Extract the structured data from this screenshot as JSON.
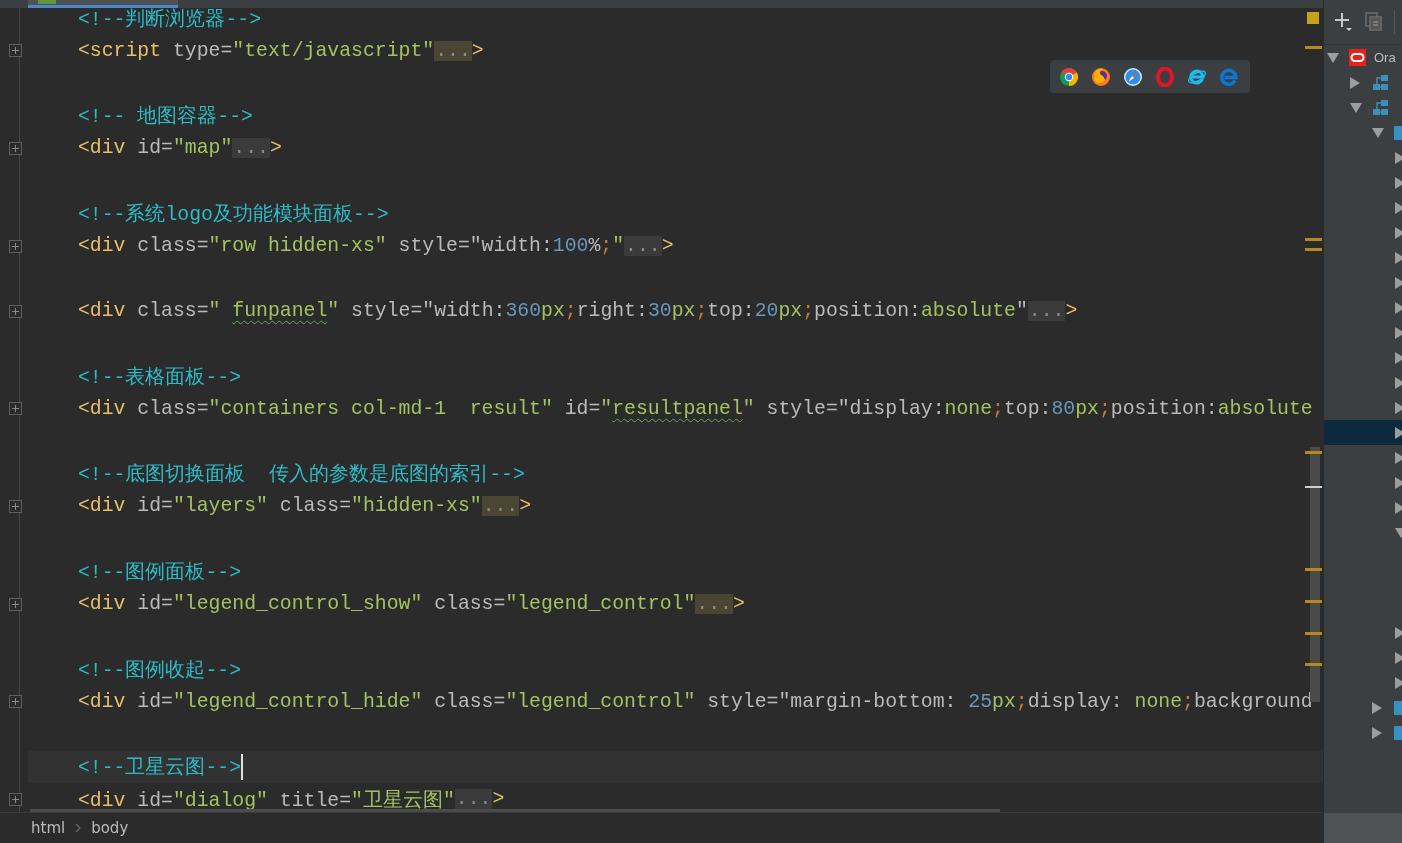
{
  "editor": {
    "lines": [
      {
        "kind": "code",
        "current": false,
        "collapsed": false,
        "tokens": [
          {
            "kind": "comment",
            "text": "<!--判断浏览器-->"
          }
        ]
      },
      {
        "kind": "code",
        "current": false,
        "collapsed": true,
        "tokens": [
          {
            "kind": "tag",
            "text": "<script"
          },
          {
            "kind": "attr",
            "text": " type="
          },
          {
            "kind": "value",
            "text": "\"text/javascript\""
          },
          {
            "kind": "fold",
            "text": "...",
            "highlighted": true
          },
          {
            "kind": "tag",
            "text": ">"
          }
        ]
      },
      {
        "kind": "blank",
        "current": false,
        "collapsed": false
      },
      {
        "kind": "code",
        "current": false,
        "collapsed": false,
        "tokens": [
          {
            "kind": "comment",
            "text": "<!-- 地图容器-->"
          }
        ]
      },
      {
        "kind": "code",
        "current": false,
        "collapsed": true,
        "tokens": [
          {
            "kind": "tag",
            "text": "<div"
          },
          {
            "kind": "attr",
            "text": " id="
          },
          {
            "kind": "value",
            "text": "\"map\""
          },
          {
            "kind": "fold",
            "text": "...",
            "highlighted": false
          },
          {
            "kind": "tag",
            "text": ">"
          }
        ]
      },
      {
        "kind": "blank",
        "current": false,
        "collapsed": false
      },
      {
        "kind": "code",
        "current": false,
        "collapsed": false,
        "tokens": [
          {
            "kind": "comment",
            "text": "<!--系统logo及功能模块面板-->"
          }
        ]
      },
      {
        "kind": "code",
        "current": false,
        "collapsed": true,
        "tokens": [
          {
            "kind": "tag",
            "text": "<div"
          },
          {
            "kind": "attr",
            "text": " class="
          },
          {
            "kind": "value",
            "text": "\"row hidden-xs\""
          },
          {
            "kind": "attr",
            "text": " style=\"width:"
          },
          {
            "kind": "number",
            "text": "100"
          },
          {
            "kind": "attr",
            "text": "%"
          },
          {
            "kind": "punct",
            "text": ";"
          },
          {
            "kind": "value",
            "text": "\""
          },
          {
            "kind": "fold",
            "text": "...",
            "highlighted": false
          },
          {
            "kind": "tag",
            "text": ">"
          }
        ]
      },
      {
        "kind": "blank",
        "current": false,
        "collapsed": false
      },
      {
        "kind": "code",
        "current": false,
        "collapsed": true,
        "tokens": [
          {
            "kind": "tag",
            "text": "<div"
          },
          {
            "kind": "attr",
            "text": " class="
          },
          {
            "kind": "value",
            "text": "\" "
          },
          {
            "kind": "typo",
            "text": "funpanel"
          },
          {
            "kind": "value",
            "text": "\""
          },
          {
            "kind": "attr",
            "text": " style=\"width:"
          },
          {
            "kind": "number",
            "text": "360"
          },
          {
            "kind": "value",
            "text": "px"
          },
          {
            "kind": "punct",
            "text": ";"
          },
          {
            "kind": "attr",
            "text": "right:"
          },
          {
            "kind": "number",
            "text": "30"
          },
          {
            "kind": "value",
            "text": "px"
          },
          {
            "kind": "punct",
            "text": ";"
          },
          {
            "kind": "attr",
            "text": "top:"
          },
          {
            "kind": "number",
            "text": "20"
          },
          {
            "kind": "value",
            "text": "px"
          },
          {
            "kind": "punct",
            "text": ";"
          },
          {
            "kind": "attr",
            "text": "position:"
          },
          {
            "kind": "value",
            "text": "absolute"
          },
          {
            "kind": "attr",
            "text": "\""
          },
          {
            "kind": "fold",
            "text": "...",
            "highlighted": false
          },
          {
            "kind": "tag",
            "text": ">"
          }
        ]
      },
      {
        "kind": "blank",
        "current": false,
        "collapsed": false
      },
      {
        "kind": "code",
        "current": false,
        "collapsed": false,
        "tokens": [
          {
            "kind": "comment",
            "text": "<!--表格面板-->"
          }
        ]
      },
      {
        "kind": "code",
        "current": false,
        "collapsed": true,
        "tokens": [
          {
            "kind": "tag",
            "text": "<div"
          },
          {
            "kind": "attr",
            "text": " class="
          },
          {
            "kind": "value",
            "text": "\"containers col-md-1  result\""
          },
          {
            "kind": "attr",
            "text": " id="
          },
          {
            "kind": "value",
            "text": "\""
          },
          {
            "kind": "typo",
            "text": "resultpanel"
          },
          {
            "kind": "value",
            "text": "\""
          },
          {
            "kind": "attr",
            "text": " style=\"display:"
          },
          {
            "kind": "value",
            "text": "none"
          },
          {
            "kind": "punct",
            "text": ";"
          },
          {
            "kind": "attr",
            "text": "top:"
          },
          {
            "kind": "number",
            "text": "80"
          },
          {
            "kind": "value",
            "text": "px"
          },
          {
            "kind": "punct",
            "text": ";"
          },
          {
            "kind": "attr",
            "text": "position:"
          },
          {
            "kind": "value",
            "text": "absolute"
          }
        ]
      },
      {
        "kind": "blank",
        "current": false,
        "collapsed": false
      },
      {
        "kind": "code",
        "current": false,
        "collapsed": false,
        "tokens": [
          {
            "kind": "comment",
            "text": "<!--底图切换面板  传入的参数是底图的索引-->"
          }
        ]
      },
      {
        "kind": "code",
        "current": false,
        "collapsed": true,
        "tokens": [
          {
            "kind": "tag",
            "text": "<div"
          },
          {
            "kind": "attr",
            "text": " id="
          },
          {
            "kind": "value",
            "text": "\"layers\""
          },
          {
            "kind": "attr",
            "text": " class="
          },
          {
            "kind": "value",
            "text": "\"hidden-xs\""
          },
          {
            "kind": "fold",
            "text": "...",
            "highlighted": true
          },
          {
            "kind": "tag",
            "text": ">"
          }
        ]
      },
      {
        "kind": "blank",
        "current": false,
        "collapsed": false
      },
      {
        "kind": "code",
        "current": false,
        "collapsed": false,
        "tokens": [
          {
            "kind": "comment",
            "text": "<!--图例面板-->"
          }
        ]
      },
      {
        "kind": "code",
        "current": false,
        "collapsed": true,
        "tokens": [
          {
            "kind": "tag",
            "text": "<div"
          },
          {
            "kind": "attr",
            "text": " id="
          },
          {
            "kind": "value",
            "text": "\"legend_control_show\""
          },
          {
            "kind": "attr",
            "text": " class="
          },
          {
            "kind": "value",
            "text": "\"legend_control\""
          },
          {
            "kind": "fold",
            "text": "...",
            "highlighted": true
          },
          {
            "kind": "tag",
            "text": ">"
          }
        ]
      },
      {
        "kind": "blank",
        "current": false,
        "collapsed": false
      },
      {
        "kind": "code",
        "current": false,
        "collapsed": false,
        "tokens": [
          {
            "kind": "comment",
            "text": "<!--图例收起-->"
          }
        ]
      },
      {
        "kind": "code",
        "current": false,
        "collapsed": true,
        "tokens": [
          {
            "kind": "tag",
            "text": "<div"
          },
          {
            "kind": "attr",
            "text": " id="
          },
          {
            "kind": "value",
            "text": "\"legend_control_hide\""
          },
          {
            "kind": "attr",
            "text": " class="
          },
          {
            "kind": "value",
            "text": "\"legend_control\""
          },
          {
            "kind": "attr",
            "text": " style=\"margin-bottom: "
          },
          {
            "kind": "number",
            "text": "25"
          },
          {
            "kind": "value",
            "text": "px"
          },
          {
            "kind": "punct",
            "text": ";"
          },
          {
            "kind": "attr",
            "text": "display: "
          },
          {
            "kind": "value",
            "text": "none"
          },
          {
            "kind": "punct",
            "text": ";"
          },
          {
            "kind": "attr",
            "text": "background"
          }
        ]
      },
      {
        "kind": "blank",
        "current": false,
        "collapsed": false
      },
      {
        "kind": "code",
        "current": true,
        "collapsed": false,
        "tokens": [
          {
            "kind": "comment",
            "text": "<!--卫星云图-->"
          }
        ]
      },
      {
        "kind": "code",
        "current": false,
        "collapsed": true,
        "tokens": [
          {
            "kind": "tag",
            "text": "<div"
          },
          {
            "kind": "attr",
            "text": " id="
          },
          {
            "kind": "value",
            "text": "\"dialog\""
          },
          {
            "kind": "attr",
            "text": " title="
          },
          {
            "kind": "value",
            "text": "\"卫星云图\""
          },
          {
            "kind": "fold",
            "text": "...",
            "highlighted": false
          },
          {
            "kind": "tag",
            "text": ">"
          }
        ]
      }
    ]
  },
  "browser_popup": {
    "browsers": [
      {
        "kind": "chrome"
      },
      {
        "kind": "firefox"
      },
      {
        "kind": "safari"
      },
      {
        "kind": "opera"
      },
      {
        "kind": "ie"
      },
      {
        "kind": "edge"
      }
    ]
  },
  "breadcrumb": [
    "html",
    "body"
  ],
  "tree": [
    {
      "kind": "oracle",
      "label": "Ora",
      "expanded": true,
      "selected": false,
      "children": [
        {
          "kind": "schema",
          "expanded": false,
          "selected": false
        },
        {
          "kind": "schema",
          "expanded": true,
          "selected": false,
          "children": [
            {
              "kind": "folder",
              "expanded": true,
              "selected": false,
              "children": [
                {
                  "kind": "item",
                  "expanded": false,
                  "selected": false
                },
                {
                  "kind": "item",
                  "expanded": false,
                  "selected": false
                },
                {
                  "kind": "item",
                  "expanded": false,
                  "selected": false
                },
                {
                  "kind": "item",
                  "expanded": false,
                  "selected": false
                },
                {
                  "kind": "item",
                  "expanded": false,
                  "selected": false
                },
                {
                  "kind": "item",
                  "expanded": false,
                  "selected": false
                },
                {
                  "kind": "item",
                  "expanded": false,
                  "selected": false
                },
                {
                  "kind": "item",
                  "expanded": false,
                  "selected": false
                },
                {
                  "kind": "item",
                  "expanded": false,
                  "selected": false
                },
                {
                  "kind": "item",
                  "expanded": false,
                  "selected": false
                },
                {
                  "kind": "item",
                  "expanded": false,
                  "selected": false
                },
                {
                  "kind": "item",
                  "expanded": false,
                  "selected": true
                },
                {
                  "kind": "item",
                  "expanded": false,
                  "selected": false
                },
                {
                  "kind": "item",
                  "expanded": false,
                  "selected": false
                },
                {
                  "kind": "item",
                  "expanded": false,
                  "selected": false
                },
                {
                  "kind": "item",
                  "expanded": true,
                  "selected": false,
                  "children": [
                    {
                      "selected": false
                    },
                    {
                      "selected": false
                    },
                    {
                      "selected": false
                    }
                  ]
                },
                {
                  "kind": "item",
                  "expanded": false,
                  "selected": false
                },
                {
                  "kind": "item",
                  "expanded": false,
                  "selected": false
                },
                {
                  "kind": "item",
                  "expanded": false,
                  "selected": false
                }
              ]
            },
            {
              "kind": "folder",
              "expanded": false,
              "selected": false
            },
            {
              "kind": "folder",
              "expanded": false,
              "selected": false
            }
          ]
        }
      ]
    }
  ]
}
